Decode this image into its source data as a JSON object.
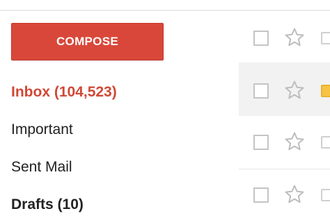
{
  "compose": {
    "label": "COMPOSE"
  },
  "nav": {
    "inbox": "Inbox (104,523)",
    "important": "Important",
    "sent": "Sent Mail",
    "drafts": "Drafts (10)"
  },
  "colors": {
    "compose_bg": "#d9473a",
    "inbox_active": "#d14836",
    "selected_row": "#f2f2f2",
    "label_yellow": "#f6c342"
  },
  "messages": [
    {
      "selected": false,
      "starred": false,
      "label_color": "none"
    },
    {
      "selected": true,
      "starred": false,
      "label_color": "yellow"
    },
    {
      "selected": false,
      "starred": false,
      "label_color": "none"
    },
    {
      "selected": false,
      "starred": false,
      "label_color": "none"
    }
  ]
}
